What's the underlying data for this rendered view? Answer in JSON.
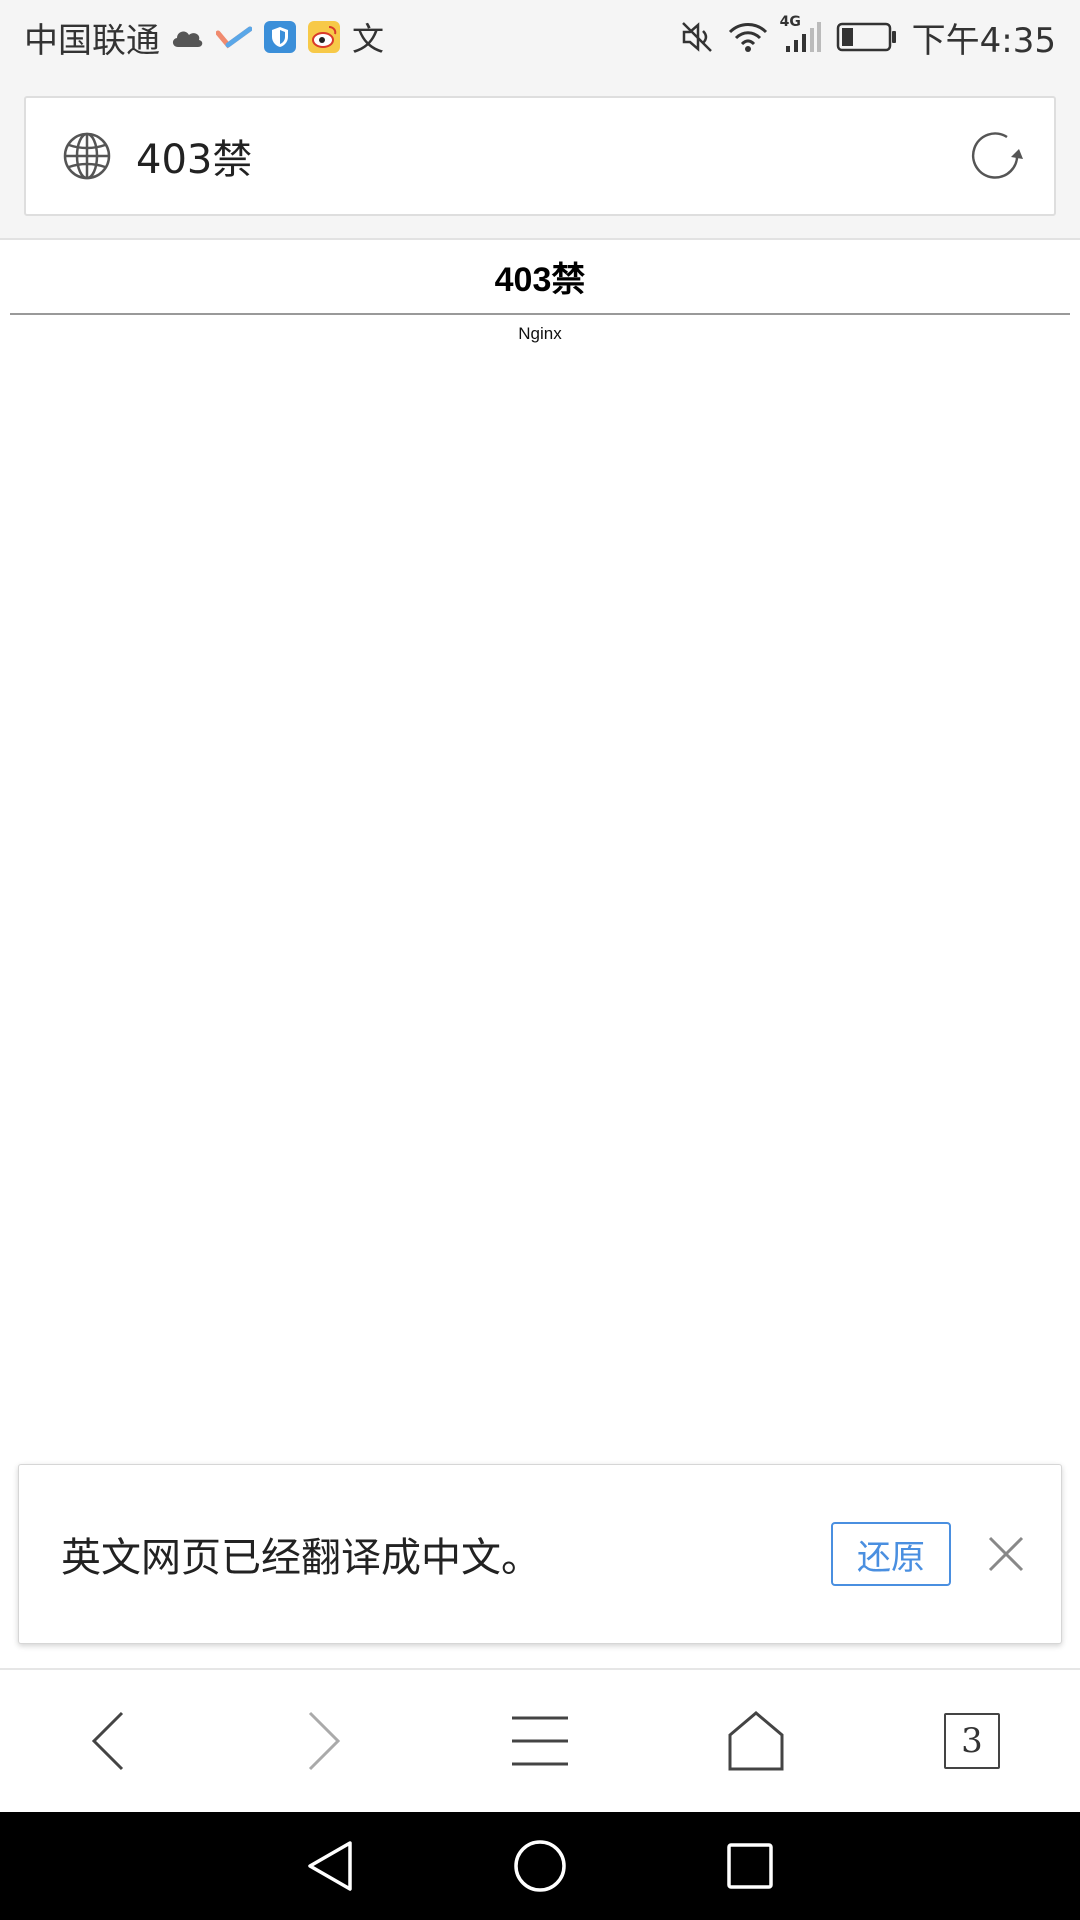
{
  "status_bar": {
    "carrier": "中国联通",
    "time": "下午4:35",
    "network_label": "4G",
    "battery_level": 0.25,
    "icons": [
      "cloud-icon",
      "app-check-icon",
      "shield-app-icon",
      "weibo-icon",
      "translate-char-icon",
      "mute-icon",
      "wifi-icon",
      "signal-icon",
      "battery-icon"
    ],
    "translate_char": "文",
    "colors": {
      "background": "#f5f5f5",
      "shield_app": "#3b8fd9",
      "weibo_app": "#f7c948"
    }
  },
  "url_bar": {
    "title": "403禁",
    "icons": [
      "globe-icon",
      "reload-icon"
    ]
  },
  "page": {
    "heading": "403禁",
    "server": "Nginx"
  },
  "translate_banner": {
    "message": "英文网页已经翻译成中文。",
    "restore_label": "还原",
    "accent_color": "#4a8fe0"
  },
  "browser_nav": {
    "tabs_count": "3",
    "icons": [
      "back-icon",
      "forward-icon",
      "menu-icon",
      "home-icon",
      "tabs-icon"
    ]
  },
  "system_nav": {
    "icons": [
      "system-back-icon",
      "system-home-icon",
      "system-recents-icon"
    ]
  }
}
